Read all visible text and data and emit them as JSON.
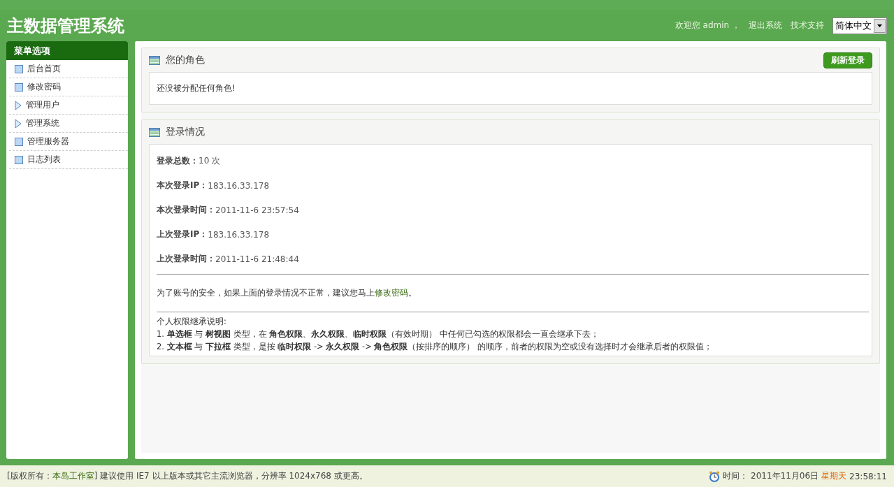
{
  "header": {
    "title": "主数据管理系统",
    "welcome": "欢迎您 admin ，",
    "links": [
      "退出系统",
      "技术支持"
    ],
    "language": {
      "value": "简体中文"
    }
  },
  "sidebar": {
    "title": "菜单选项",
    "items": [
      {
        "label": "后台首页",
        "kind": "page"
      },
      {
        "label": "修改密码",
        "kind": "page"
      },
      {
        "label": "管理用户",
        "kind": "group"
      },
      {
        "label": "管理系统",
        "kind": "group"
      },
      {
        "label": "管理服务器",
        "kind": "page"
      },
      {
        "label": "日志列表",
        "kind": "page"
      }
    ]
  },
  "role_panel": {
    "title": "您的角色",
    "button": "刷新登录",
    "message": "还没被分配任何角色!"
  },
  "login_panel": {
    "title": "登录情况",
    "stats": [
      {
        "label": "登录总数：",
        "value": "10 次"
      },
      {
        "label": "本次登录IP：",
        "value": "183.16.33.178"
      },
      {
        "label": "本次登录时间：",
        "value": "2011-11-6 23:57:54"
      },
      {
        "label": "上次登录IP：",
        "value": "183.16.33.178"
      },
      {
        "label": "上次登录时间：",
        "value": "2011-11-6 21:48:44"
      }
    ],
    "notice": {
      "before": "为了账号的安全，如果上面的登录情况不正常，建议您马上",
      "link": "修改密码",
      "after": "。"
    },
    "rules_title": "个人权限继承说明:",
    "rules": [
      "1. **单选框** 与 **树视图** 类型，在 **角色权限**、**永久权限**、**临时权限**（有效时期） 中任何已勾选的权限都会一直会继承下去；",
      "2. **文本框** 与 **下拉框** 类型，是按 **临时权限** -> **永久权限** -> **角色权限**（按排序的顺序） 的顺序，前者的权限为空或没有选择时才会继承后者的权限值；"
    ]
  },
  "footer": {
    "copyright_prefix": "[版权所有：",
    "company": "本岛工作室",
    "copyright_suffix": "] 建议使用 IE7 以上版本或其它主流浏览器，分辨率 1024x768 或更高。",
    "time_label": "时间：",
    "date": "2011年11月06日",
    "weekday": "星期天",
    "time": "23:58:11"
  }
}
